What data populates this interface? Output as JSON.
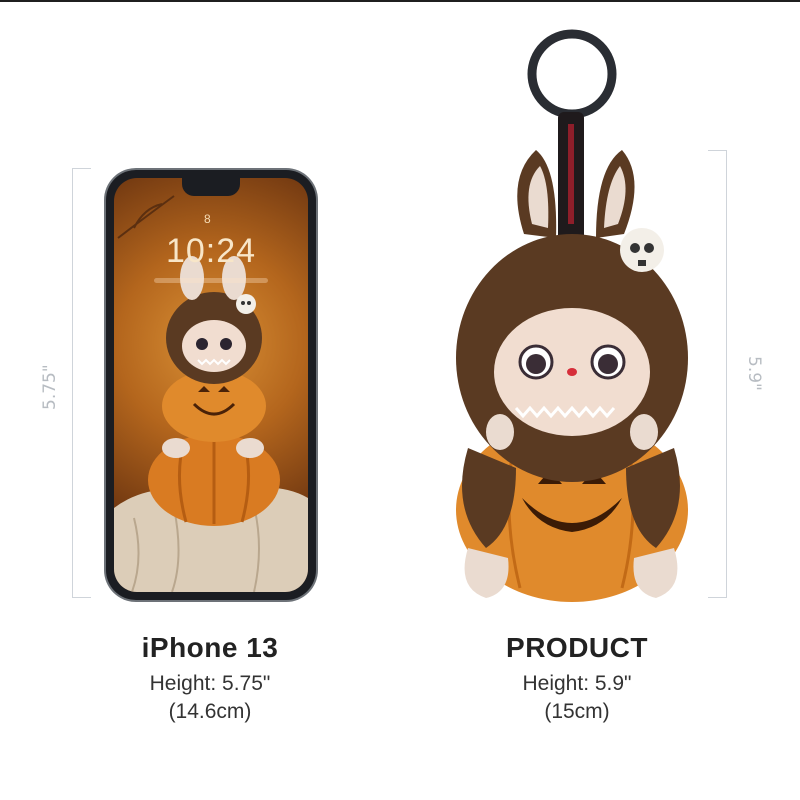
{
  "dimensions": {
    "left_label": "5.75\"",
    "right_label": "5.9\""
  },
  "phone": {
    "time": "10:24",
    "lock_symbol": "8"
  },
  "captions": {
    "left": {
      "title": "iPhone 13",
      "height": "Height: 5.75\"",
      "metric": "(14.6cm)"
    },
    "right": {
      "title": "PRODUCT",
      "height": "Height: 5.9\"",
      "metric": "(15cm)"
    }
  },
  "colors": {
    "fur": "#5a3a22",
    "pumpkin": "#e08a2c",
    "face": "#f1ddd0",
    "bracket": "#cfd4da"
  }
}
